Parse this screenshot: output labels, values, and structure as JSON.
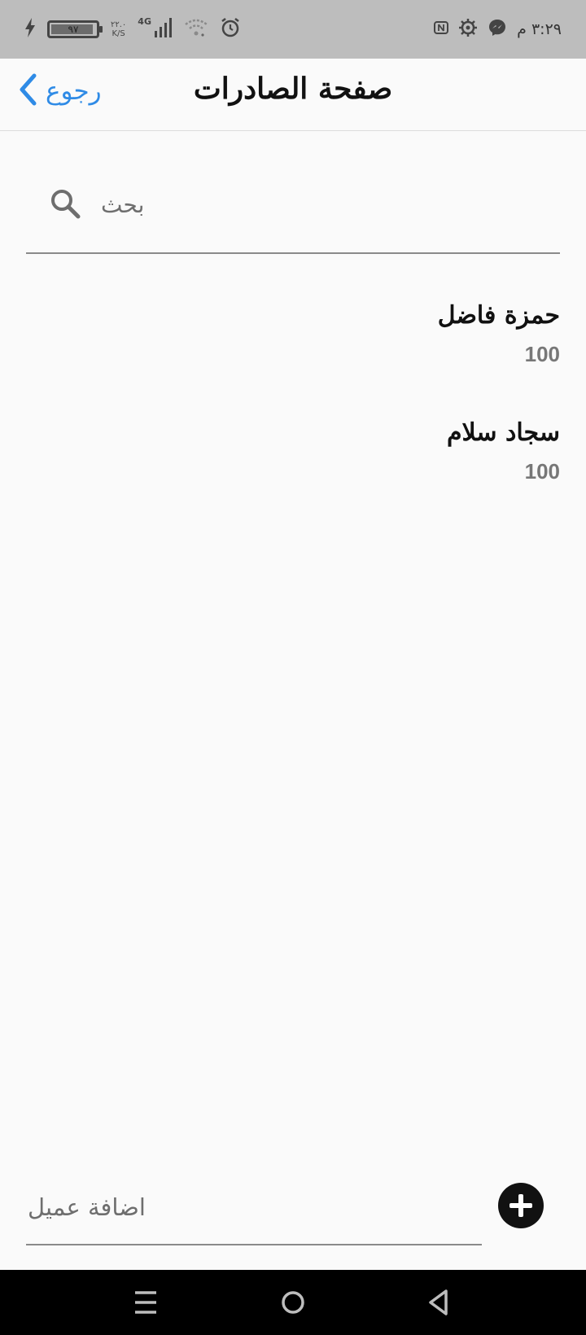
{
  "status_bar": {
    "battery_level": "٩٧",
    "net_speed_value": "٢٢.٠",
    "net_speed_unit": "K/S",
    "network_type": "4G",
    "clock": "٣:٢٩ م",
    "icons": [
      "charging-icon",
      "battery-icon",
      "cell-signal-icon",
      "wifi-icon",
      "alarm-icon",
      "nfc-icon",
      "settings-gear-icon",
      "messenger-icon"
    ]
  },
  "header": {
    "back_label": "رجوع",
    "title": "صفحة الصادرات"
  },
  "search": {
    "placeholder": "بحث"
  },
  "customers": [
    {
      "name": "حمزة فاضل",
      "amount": "100"
    },
    {
      "name": "سجاد سلام",
      "amount": "100"
    }
  ],
  "add_customer": {
    "placeholder": "اضافة عميل"
  },
  "colors": {
    "accent": "#2f8be6",
    "status_bar_bg": "#bdbdbd",
    "nav_bar_bg": "#000000"
  }
}
